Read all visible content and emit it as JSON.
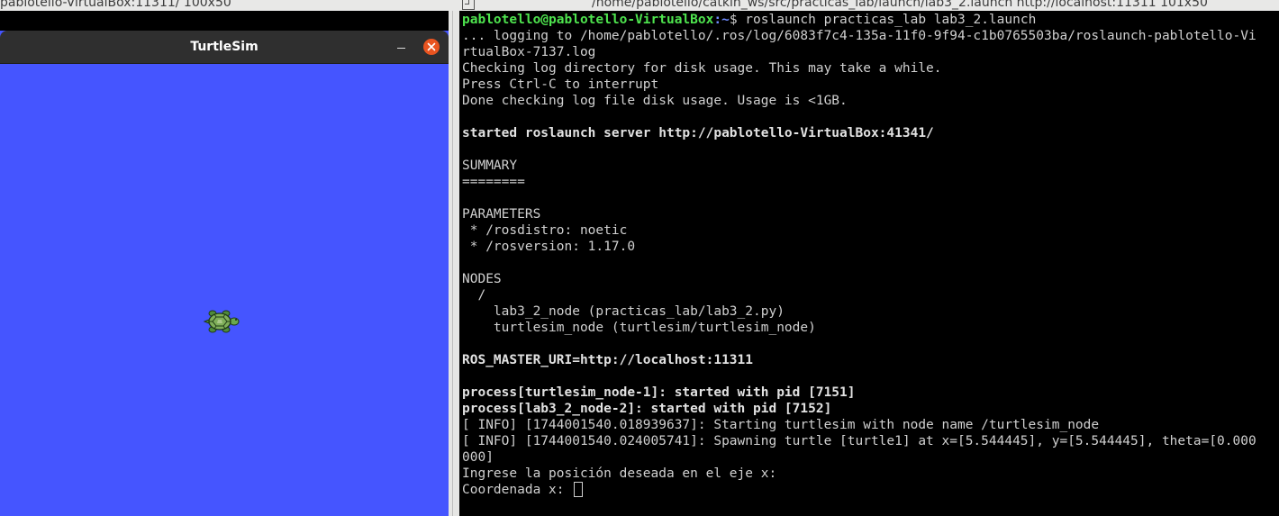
{
  "topbar": {
    "left_title": "pablotello-VirtualBox:11311/ 100x50",
    "right_title": "/home/pablotello/catkin_ws/src/practicas_lab/launch/lab3_2.launch http://localhost:11311 101x50"
  },
  "turtlesim": {
    "title": "TurtleSim",
    "canvas_color": "#4555ff"
  },
  "terminal": {
    "prompt_user": "pablotello@pablotello-VirtualBox",
    "prompt_path": ":~",
    "prompt_symbol": "$ ",
    "command": "roslaunch practicas_lab lab3_2.launch",
    "lines": [
      "... logging to /home/pablotello/.ros/log/6083f7c4-135a-11f0-9f94-c1b0765503ba/roslaunch-pablotello-Vi",
      "rtualBox-7137.log",
      "Checking log directory for disk usage. This may take a while.",
      "Press Ctrl-C to interrupt",
      "Done checking log file disk usage. Usage is <1GB.",
      "",
      "started roslaunch server http://pablotello-VirtualBox:41341/",
      "",
      "SUMMARY",
      "========",
      "",
      "PARAMETERS",
      " * /rosdistro: noetic",
      " * /rosversion: 1.17.0",
      "",
      "NODES",
      "  /",
      "    lab3_2_node (practicas_lab/lab3_2.py)",
      "    turtlesim_node (turtlesim/turtlesim_node)",
      "",
      "ROS_MASTER_URI=http://localhost:11311",
      "",
      "process[turtlesim_node-1]: started with pid [7151]",
      "process[lab3_2_node-2]: started with pid [7152]",
      "[ INFO] [1744001540.018939637]: Starting turtlesim with node name /turtlesim_node",
      "[ INFO] [1744001540.024005741]: Spawning turtle [turtle1] at x=[5.544445], y=[5.544445], theta=[0.000",
      "000]",
      "Ingrese la posición deseada en el eje x:"
    ],
    "input_prompt": "Coordenada x: "
  }
}
